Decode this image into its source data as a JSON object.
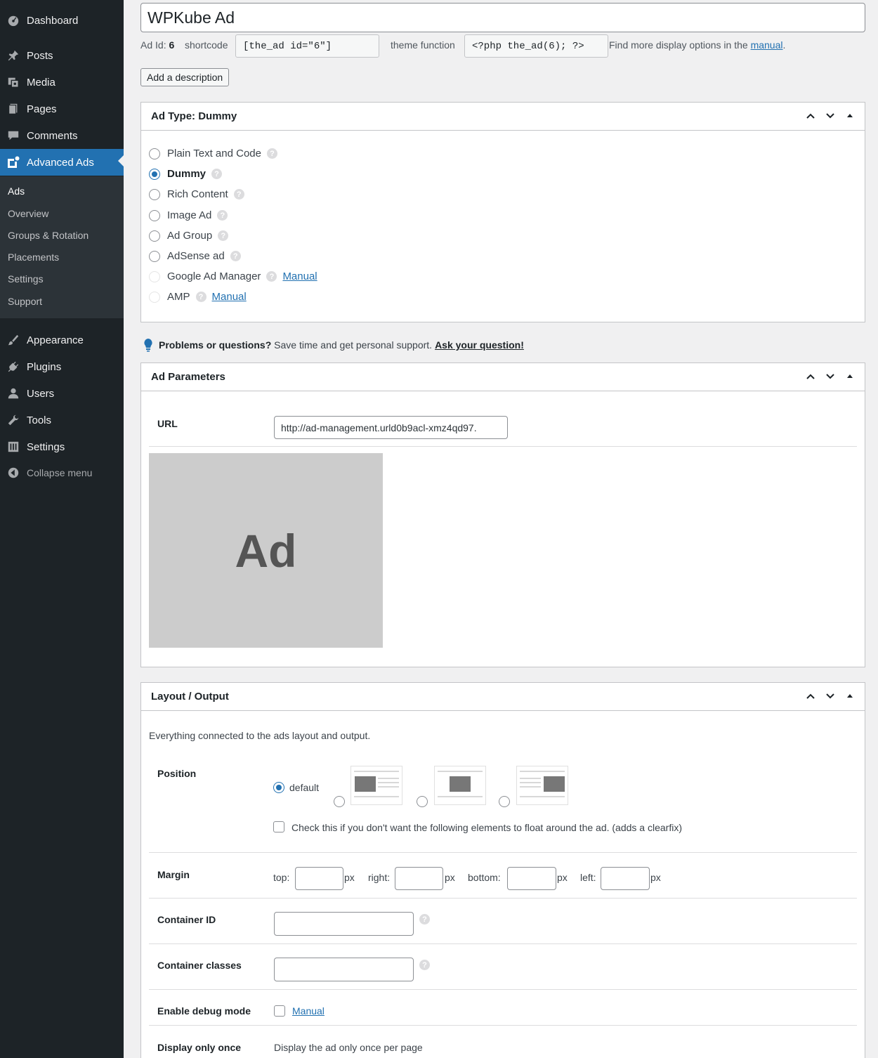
{
  "sidebar": {
    "items": [
      {
        "label": "Dashboard",
        "icon": "dashboard-icon"
      },
      {
        "label": "Posts",
        "icon": "pin-icon"
      },
      {
        "label": "Media",
        "icon": "media-icon"
      },
      {
        "label": "Pages",
        "icon": "pages-icon"
      },
      {
        "label": "Comments",
        "icon": "comment-icon"
      },
      {
        "label": "Advanced Ads",
        "icon": "advanced-ads-icon"
      }
    ],
    "submenu": [
      "Ads",
      "Overview",
      "Groups & Rotation",
      "Placements",
      "Settings",
      "Support"
    ],
    "items2": [
      {
        "label": "Appearance",
        "icon": "brush-icon"
      },
      {
        "label": "Plugins",
        "icon": "plug-icon"
      },
      {
        "label": "Users",
        "icon": "user-icon"
      },
      {
        "label": "Tools",
        "icon": "wrench-icon"
      },
      {
        "label": "Settings",
        "icon": "settings-icon"
      }
    ],
    "collapse": "Collapse menu"
  },
  "ad": {
    "title": "WPKube Ad",
    "id_label": "Ad Id:",
    "id_value": "6",
    "shortcode_label": "shortcode",
    "shortcode": "[the_ad id=\"6\"]",
    "theme_function_label": "theme function",
    "theme_function": "<?php the_ad(6); ?>",
    "more_options_text": "Find more display options in the",
    "manual_link": "manual",
    "add_description": "Add a description"
  },
  "ad_type": {
    "title": "Ad Type: Dummy",
    "options": [
      {
        "label": "Plain Text and Code",
        "selected": false,
        "disabled": false
      },
      {
        "label": "Dummy",
        "selected": true,
        "disabled": false
      },
      {
        "label": "Rich Content",
        "selected": false,
        "disabled": false
      },
      {
        "label": "Image Ad",
        "selected": false,
        "disabled": false
      },
      {
        "label": "Ad Group",
        "selected": false,
        "disabled": false
      },
      {
        "label": "AdSense ad",
        "selected": false,
        "disabled": false
      },
      {
        "label": "Google Ad Manager",
        "selected": false,
        "disabled": true,
        "link": "Manual"
      },
      {
        "label": "AMP",
        "selected": false,
        "disabled": true,
        "link": "Manual"
      }
    ]
  },
  "support": {
    "bold": "Problems or questions?",
    "text": "Save time and get personal support.",
    "link": "Ask your question!"
  },
  "ad_params": {
    "title": "Ad Parameters",
    "url_label": "URL",
    "url_value": "http://ad-management.urld0b9acl-xmz4qd97.",
    "preview_text": "Ad"
  },
  "layout": {
    "title": "Layout / Output",
    "description": "Everything connected to the ads layout and output.",
    "position_label": "Position",
    "position_default": "default",
    "clearfix_text": "Check this if you don't want the following elements to float around the ad. (adds a clearfix)",
    "margin_label": "Margin",
    "margin_top": "top:",
    "margin_right": "right:",
    "margin_bottom": "bottom:",
    "margin_left": "left:",
    "px": "px",
    "container_id_label": "Container ID",
    "container_classes_label": "Container classes",
    "debug_label": "Enable debug mode",
    "debug_link": "Manual",
    "display_once_label": "Display only once",
    "display_once_text": "Display the ad only once per page"
  },
  "colors": {
    "sidebar_bg": "#1d2327",
    "accent": "#2271b1",
    "submenu_bg": "#2c3338"
  }
}
